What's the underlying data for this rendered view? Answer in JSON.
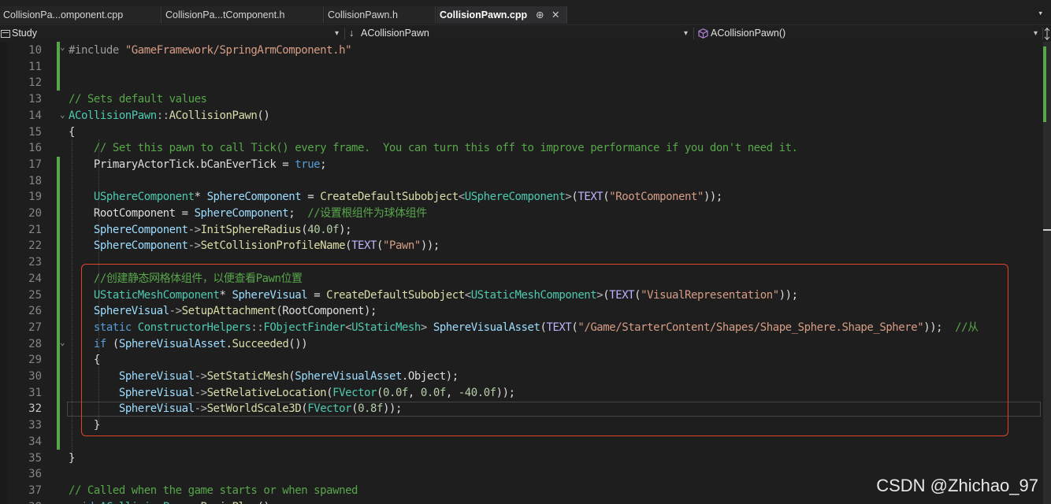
{
  "tabs": [
    {
      "label": "CollisionPa...omponent.cpp",
      "active": false
    },
    {
      "label": "CollisionPa...tComponent.h",
      "active": false
    },
    {
      "label": "CollisionPawn.h",
      "active": false
    },
    {
      "label": "CollisionPawn.cpp",
      "active": true,
      "pin_glyph": "⊕",
      "close_glyph": "✕"
    }
  ],
  "tabbar_overflow_glyph": "▾",
  "navbar": {
    "project": "Study",
    "project_icon": "project-icon",
    "class_scope": "ACollisionPawn",
    "class_scope_glyph": "↓",
    "member_scope": "ACollisionPawn()",
    "member_icon": "cube-method-icon",
    "dropdown_glyph": "▾"
  },
  "editor": {
    "current_line": 32,
    "lines": [
      {
        "n": 10,
        "tokens": [
          [
            "pp",
            "#include "
          ],
          [
            "str",
            "\"GameFramework/SpringArmComponent.h\""
          ]
        ]
      },
      {
        "n": 11,
        "tokens": []
      },
      {
        "n": 12,
        "tokens": []
      },
      {
        "n": 13,
        "tokens": [
          [
            "cm",
            "// Sets default values"
          ]
        ]
      },
      {
        "n": 14,
        "tokens": [
          [
            "cls",
            "ACollisionPawn"
          ],
          [
            "op",
            "::"
          ],
          [
            "fn",
            "ACollisionPawn"
          ],
          [
            "p",
            "()"
          ]
        ]
      },
      {
        "n": 15,
        "tokens": [
          [
            "p",
            "{"
          ]
        ]
      },
      {
        "n": 16,
        "tokens": [
          [
            "p",
            "    "
          ],
          [
            "cm",
            "// Set this pawn to call Tick() every frame.  You can turn this off to improve performance if you don't need it."
          ]
        ]
      },
      {
        "n": 17,
        "tokens": [
          [
            "p",
            "    PrimaryActorTick.bCanEverTick = "
          ],
          [
            "kw",
            "true"
          ],
          [
            "p",
            ";"
          ]
        ]
      },
      {
        "n": 18,
        "tokens": []
      },
      {
        "n": 19,
        "tokens": [
          [
            "p",
            "    "
          ],
          [
            "cls",
            "USphereComponent"
          ],
          [
            "p",
            "* "
          ],
          [
            "var",
            "SphereComponent"
          ],
          [
            "p",
            " = "
          ],
          [
            "fn",
            "CreateDefaultSubobject"
          ],
          [
            "op",
            "<"
          ],
          [
            "cls",
            "USphereComponent"
          ],
          [
            "op",
            ">"
          ],
          [
            "p",
            "("
          ],
          [
            "mac",
            "TEXT"
          ],
          [
            "p",
            "("
          ],
          [
            "str",
            "\"RootComponent\""
          ],
          [
            "p",
            "));"
          ]
        ]
      },
      {
        "n": 20,
        "tokens": [
          [
            "p",
            "    RootComponent = "
          ],
          [
            "var",
            "SphereComponent"
          ],
          [
            "p",
            ";  "
          ],
          [
            "cm",
            "//设置根组件为球体组件"
          ]
        ]
      },
      {
        "n": 21,
        "tokens": [
          [
            "p",
            "    "
          ],
          [
            "var",
            "SphereComponent"
          ],
          [
            "op",
            "->"
          ],
          [
            "fn",
            "InitSphereRadius"
          ],
          [
            "p",
            "("
          ],
          [
            "num",
            "40.0f"
          ],
          [
            "p",
            ");"
          ]
        ]
      },
      {
        "n": 22,
        "tokens": [
          [
            "p",
            "    "
          ],
          [
            "var",
            "SphereComponent"
          ],
          [
            "op",
            "->"
          ],
          [
            "fn",
            "SetCollisionProfileName"
          ],
          [
            "p",
            "("
          ],
          [
            "mac",
            "TEXT"
          ],
          [
            "p",
            "("
          ],
          [
            "str",
            "\"Pawn\""
          ],
          [
            "p",
            "));"
          ]
        ]
      },
      {
        "n": 23,
        "tokens": []
      },
      {
        "n": 24,
        "tokens": [
          [
            "p",
            "    "
          ],
          [
            "cm",
            "//创建静态网格体组件，以便查看Pawn位置"
          ]
        ]
      },
      {
        "n": 25,
        "tokens": [
          [
            "p",
            "    "
          ],
          [
            "cls",
            "UStaticMeshComponent"
          ],
          [
            "p",
            "* "
          ],
          [
            "var",
            "SphereVisual"
          ],
          [
            "p",
            " = "
          ],
          [
            "fn",
            "CreateDefaultSubobject"
          ],
          [
            "op",
            "<"
          ],
          [
            "cls",
            "UStaticMeshComponent"
          ],
          [
            "op",
            ">"
          ],
          [
            "p",
            "("
          ],
          [
            "mac",
            "TEXT"
          ],
          [
            "p",
            "("
          ],
          [
            "str",
            "\"VisualRepresentation\""
          ],
          [
            "p",
            "));"
          ]
        ]
      },
      {
        "n": 26,
        "tokens": [
          [
            "p",
            "    "
          ],
          [
            "var",
            "SphereVisual"
          ],
          [
            "op",
            "->"
          ],
          [
            "fn",
            "SetupAttachment"
          ],
          [
            "p",
            "(RootComponent);"
          ]
        ]
      },
      {
        "n": 27,
        "tokens": [
          [
            "p",
            "    "
          ],
          [
            "kw",
            "static"
          ],
          [
            "p",
            " "
          ],
          [
            "cls",
            "ConstructorHelpers"
          ],
          [
            "op",
            "::"
          ],
          [
            "cls",
            "FObjectFinder"
          ],
          [
            "op",
            "<"
          ],
          [
            "cls",
            "UStaticMesh"
          ],
          [
            "op",
            ">"
          ],
          [
            "p",
            " "
          ],
          [
            "var",
            "SphereVisualAsset"
          ],
          [
            "p",
            "("
          ],
          [
            "mac",
            "TEXT"
          ],
          [
            "p",
            "("
          ],
          [
            "str",
            "\"/Game/StarterContent/Shapes/Shape_Sphere.Shape_Sphere\""
          ],
          [
            "p",
            "));  "
          ],
          [
            "cm",
            "//从"
          ]
        ]
      },
      {
        "n": 28,
        "tokens": [
          [
            "p",
            "    "
          ],
          [
            "kw",
            "if"
          ],
          [
            "p",
            " ("
          ],
          [
            "var",
            "SphereVisualAsset"
          ],
          [
            "p",
            "."
          ],
          [
            "fn",
            "Succeeded"
          ],
          [
            "p",
            "())"
          ]
        ]
      },
      {
        "n": 29,
        "tokens": [
          [
            "p",
            "    {"
          ]
        ]
      },
      {
        "n": 30,
        "tokens": [
          [
            "p",
            "        "
          ],
          [
            "var",
            "SphereVisual"
          ],
          [
            "op",
            "->"
          ],
          [
            "fn",
            "SetStaticMesh"
          ],
          [
            "p",
            "("
          ],
          [
            "var",
            "SphereVisualAsset"
          ],
          [
            "p",
            ".Object);"
          ]
        ]
      },
      {
        "n": 31,
        "tokens": [
          [
            "p",
            "        "
          ],
          [
            "var",
            "SphereVisual"
          ],
          [
            "op",
            "->"
          ],
          [
            "fn",
            "SetRelativeLocation"
          ],
          [
            "p",
            "("
          ],
          [
            "cls",
            "FVector"
          ],
          [
            "p",
            "("
          ],
          [
            "num",
            "0.0f"
          ],
          [
            "p",
            ", "
          ],
          [
            "num",
            "0.0f"
          ],
          [
            "p",
            ", "
          ],
          [
            "num",
            "-40.0f"
          ],
          [
            "p",
            "));"
          ]
        ]
      },
      {
        "n": 32,
        "tokens": [
          [
            "p",
            "        "
          ],
          [
            "var",
            "SphereVisual"
          ],
          [
            "op",
            "->"
          ],
          [
            "fn",
            "SetWorldScale3D"
          ],
          [
            "p",
            "("
          ],
          [
            "cls",
            "FVector"
          ],
          [
            "p",
            "("
          ],
          [
            "num",
            "0.8f"
          ],
          [
            "p",
            "));"
          ]
        ]
      },
      {
        "n": 33,
        "tokens": [
          [
            "p",
            "    }"
          ]
        ]
      },
      {
        "n": 34,
        "tokens": []
      },
      {
        "n": 35,
        "tokens": [
          [
            "p",
            "}"
          ]
        ]
      },
      {
        "n": 36,
        "tokens": []
      },
      {
        "n": 37,
        "tokens": [
          [
            "cm",
            "// Called when the game starts or when spawned"
          ]
        ]
      },
      {
        "n": 38,
        "tokens": [
          [
            "kw",
            "void"
          ],
          [
            "p",
            " "
          ],
          [
            "cls",
            "ACollisionPawn"
          ],
          [
            "op",
            "::"
          ],
          [
            "fn",
            "BeginPlay"
          ],
          [
            "p",
            "()"
          ]
        ]
      }
    ]
  },
  "watermark": "CSDN @Zhichao_97",
  "colors": {
    "background": "#1e1e1e",
    "comment": "#57a64a",
    "string": "#d69d85",
    "type": "#4ec9b0",
    "function": "#dcdcaa",
    "keyword": "#569cd6",
    "variable": "#9cdcfe",
    "number": "#b5cea8",
    "highlight_box": "#e0452b"
  }
}
